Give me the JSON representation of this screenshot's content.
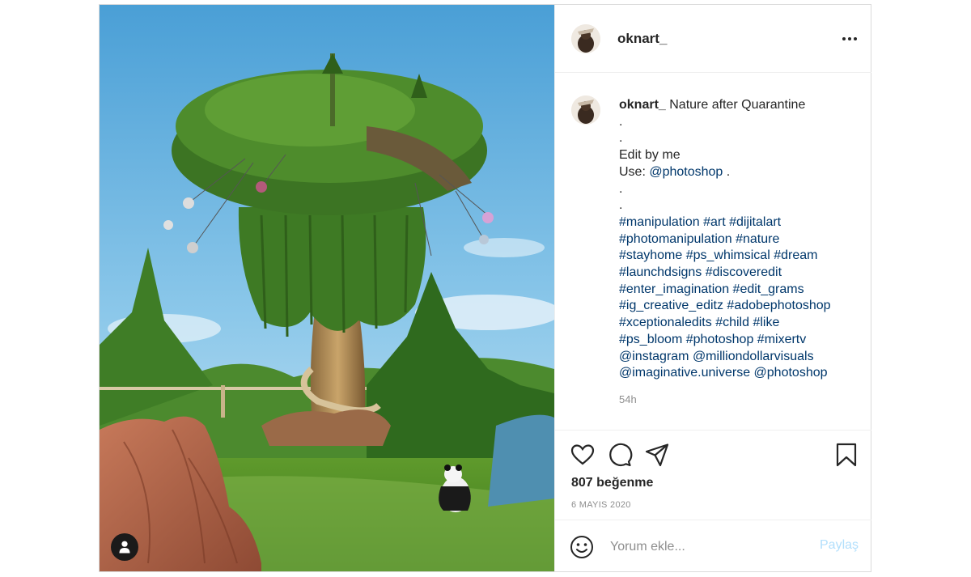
{
  "post": {
    "username": "oknart_",
    "more_icon": "more-options-icon",
    "caption": {
      "author": "oknart_",
      "first_line": " Nature after Quarantine",
      "dots1": ".",
      "dots2": ".",
      "edit": "Edit by me",
      "use_prefix": "Use: ",
      "use_link": "@photoshop",
      "use_suffix": " .",
      "dots3": ".",
      "dots4": ".",
      "hashtags": [
        "#manipulation #art #dijitalart",
        "#photomanipulation #nature",
        "#stayhome #ps_whimsical #dream",
        "#launchdsigns #discoveredit",
        "#enter_imagination #edit_grams",
        "#ig_creative_editz #adobephotoshop",
        "#xceptionaledits #child #like",
        "#ps_bloom #photoshop #mixertv",
        "@instagram @milliondollarvisuals",
        "@imaginative.universe @photoshop"
      ]
    },
    "time_ago": "54h",
    "likes": "807 beğenme",
    "date": "6 MAYIS 2020",
    "comment_placeholder": "Yorum ekle...",
    "share_label": "Paylaş",
    "icons": [
      "heart-icon",
      "comment-icon",
      "share-icon",
      "bookmark-icon",
      "emoji-icon",
      "user-tag-icon"
    ],
    "colors": {
      "link": "#00376b",
      "share_disabled": "#b2dffc",
      "muted": "#8e8e8e"
    }
  }
}
